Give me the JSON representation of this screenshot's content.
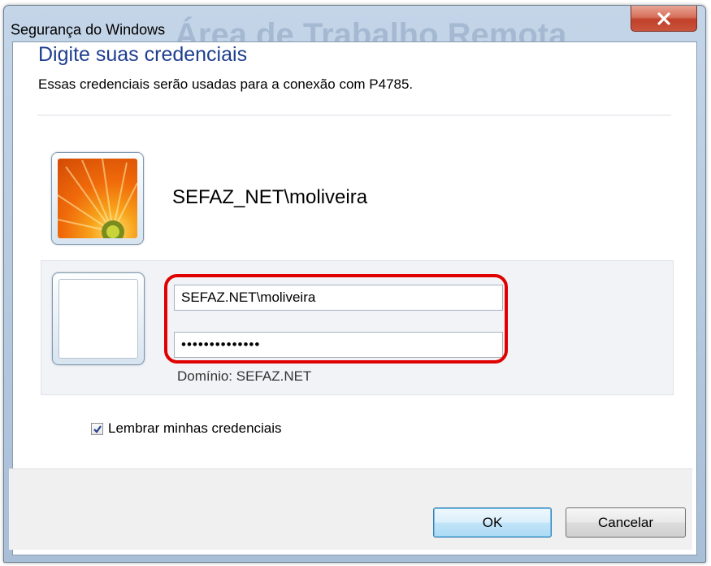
{
  "window": {
    "title": "Segurança do Windows",
    "background_text": "Área de Trabalho Remota"
  },
  "header": {
    "heading": "Digite suas credenciais",
    "subtext": "Essas credenciais serão usadas para a conexão com P4785."
  },
  "account": {
    "display_name": "SEFAZ_NET\\moliveira",
    "avatar_icon": "flower-avatar-icon"
  },
  "credentials": {
    "username_value": "SEFAZ.NET\\moliveira",
    "password_value": "••••••••••••••",
    "domain_label": "Domínio: SEFAZ.NET",
    "highlight_color": "#e00000"
  },
  "options": {
    "remember_label": "Lembrar minhas credenciais",
    "remember_checked": true
  },
  "buttons": {
    "ok_label": "OK",
    "cancel_label": "Cancelar"
  },
  "colors": {
    "heading": "#1e3e8f",
    "close_button": "#c1402a",
    "ok_button_border": "#3c7fb1"
  }
}
